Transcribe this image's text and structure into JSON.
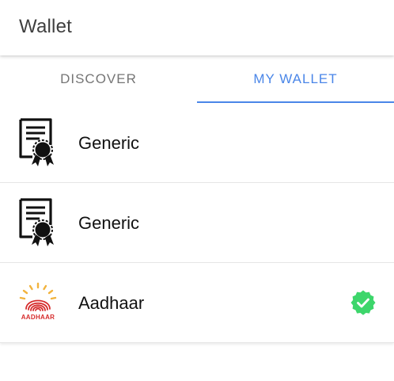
{
  "app_bar": {
    "title": "Wallet"
  },
  "tabs": [
    {
      "label": "DISCOVER",
      "active": false
    },
    {
      "label": "MY WALLET",
      "active": true
    }
  ],
  "accent_color": "#4a86e8",
  "verified_color": "#3dd66b",
  "cards": [
    {
      "label": "Generic",
      "icon": "certificate-icon",
      "verified": false
    },
    {
      "label": "Generic",
      "icon": "certificate-icon",
      "verified": false
    },
    {
      "label": "Aadhaar",
      "icon": "aadhaar-logo",
      "logo_text": "AADHAAR",
      "verified": true
    }
  ]
}
